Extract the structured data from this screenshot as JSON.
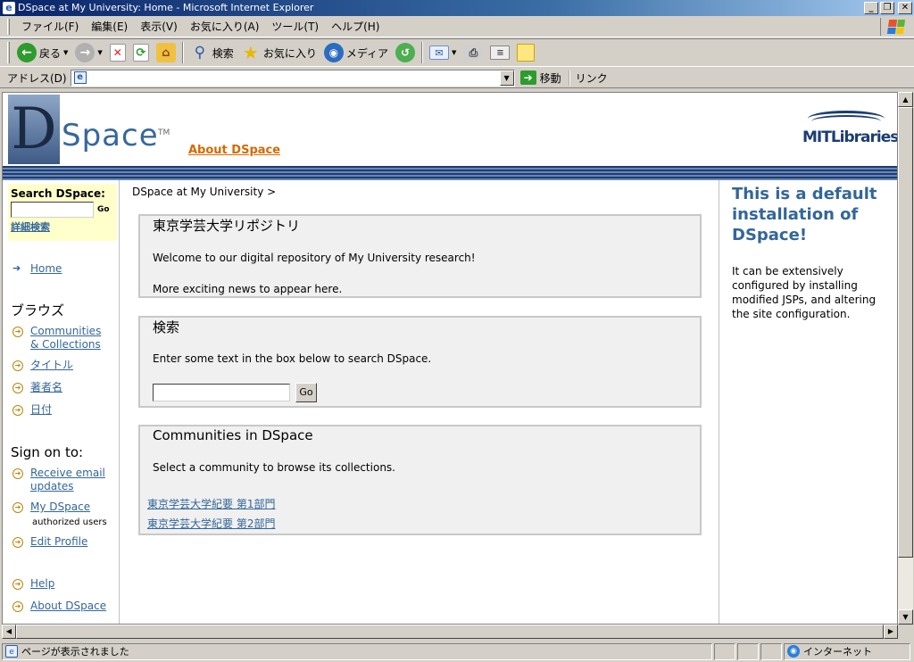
{
  "window": {
    "title": "DSpace at My University: Home - Microsoft Internet Explorer"
  },
  "menubar": {
    "items": [
      "ファイル(F)",
      "編集(E)",
      "表示(V)",
      "お気に入り(A)",
      "ツール(T)",
      "ヘルプ(H)"
    ]
  },
  "toolbar": {
    "back": "戻る",
    "search": "検索",
    "favorites": "お気に入り",
    "media": "メディア"
  },
  "addressbar": {
    "label": "アドレス(D)",
    "url": "",
    "go": "移動",
    "links": "リンク"
  },
  "header": {
    "logo_d": "D",
    "logo_space": "Space",
    "logo_tm": "TM",
    "about": "About DSpace",
    "mit": "MITLibraries"
  },
  "sidebar": {
    "search_label": "Search DSpace:",
    "go": "Go",
    "advanced": "詳細検索",
    "home": "Home",
    "browse_title": "ブラウズ",
    "browse_items": [
      "Communities & Collections",
      "タイトル",
      "著者名",
      "日付"
    ],
    "sign_on_title": "Sign on to:",
    "receive_email": "Receive email updates",
    "my_dspace": "My DSpace",
    "authorized": "authorized users",
    "edit_profile": "Edit Profile",
    "help": "Help",
    "about": "About DSpace"
  },
  "main": {
    "breadcrumb": "DSpace at My University >",
    "news": {
      "title": "東京学芸大学リポジトリ",
      "line1": "Welcome to our digital repository of My University research!",
      "line2": "More exciting news to appear here."
    },
    "search": {
      "title": "検索",
      "text": "Enter some text in the box below to search DSpace.",
      "go": "Go"
    },
    "communities": {
      "title": "Communities in DSpace",
      "text": "Select a community to browse its collections.",
      "items": [
        "東京学芸大学紀要 第1部門",
        "東京学芸大学紀要 第2部門"
      ]
    }
  },
  "right": {
    "title": "This is a default installation of DSpace!",
    "text": "It can be extensively configured by installing modified JSPs, and altering the site configuration."
  },
  "status": {
    "text": "ページが表示されました",
    "zone": "インターネット"
  }
}
